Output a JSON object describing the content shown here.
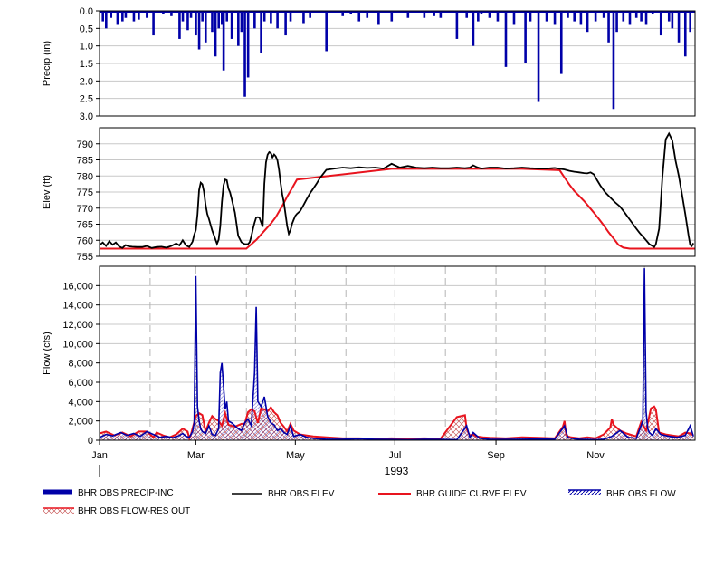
{
  "colors": {
    "precip": "#0000a8",
    "elev": "#000000",
    "guide": "#e8141e",
    "flow": "#0000a8",
    "resout": "#e8141e",
    "grid": "#c8c8c8",
    "vgrid": "#b4b4b4"
  },
  "chart_data": [
    {
      "type": "bar",
      "ylabel": "Precip (in)",
      "ylim": [
        0,
        3
      ],
      "y_inverted": true,
      "yticks": [
        "0.0",
        "0.5",
        "1.0",
        "1.5",
        "2.0",
        "2.5",
        "3.0"
      ],
      "ytick_values": [
        0,
        0.5,
        1,
        1.5,
        2,
        2.5,
        3
      ],
      "grid": true,
      "series": [
        {
          "name": "BHR OBS PRECIP-INC",
          "x_day": [
            3,
            5,
            8,
            12,
            15,
            17,
            22,
            25,
            30,
            34,
            40,
            45,
            50,
            52,
            55,
            57,
            60,
            62,
            64,
            66,
            70,
            72,
            74,
            76,
            77,
            79,
            82,
            86,
            88,
            90,
            92,
            96,
            100,
            102,
            106,
            110,
            115,
            118,
            126,
            130,
            140,
            150,
            155,
            160,
            165,
            172,
            180,
            190,
            200,
            206,
            210,
            220,
            226,
            230,
            233,
            235,
            240,
            245,
            250,
            255,
            262,
            265,
            270,
            275,
            280,
            284,
            288,
            292,
            296,
            300,
            305,
            310,
            313,
            316,
            318,
            322,
            326,
            330,
            333,
            336,
            340,
            345,
            350,
            352,
            356,
            360,
            363
          ],
          "values": [
            0.3,
            0.5,
            0.2,
            0.4,
            0.3,
            0.2,
            0.3,
            0.25,
            0.2,
            0.7,
            0.1,
            0.15,
            0.8,
            0.3,
            0.55,
            0.2,
            0.7,
            1.1,
            0.3,
            0.9,
            0.6,
            1.3,
            0.5,
            0.4,
            1.7,
            0.3,
            0.8,
            1.0,
            0.6,
            2.45,
            1.9,
            0.5,
            1.2,
            0.3,
            0.35,
            0.5,
            0.7,
            0.3,
            0.35,
            0.2,
            1.15,
            0.15,
            0.1,
            0.3,
            0.2,
            0.4,
            0.3,
            0.2,
            0.2,
            0.15,
            0.2,
            0.8,
            0.2,
            1.0,
            0.3,
            0.1,
            0.2,
            0.3,
            1.6,
            0.4,
            1.5,
            0.3,
            2.6,
            0.3,
            0.4,
            1.8,
            0.2,
            0.3,
            0.4,
            0.6,
            0.3,
            0.2,
            0.9,
            2.8,
            0.6,
            0.3,
            0.4,
            0.2,
            0.3,
            0.4,
            0.1,
            0.7,
            0.3,
            0.5,
            0.9,
            1.3,
            0.6
          ]
        }
      ]
    },
    {
      "type": "line",
      "ylabel": "Elev (ft)",
      "ylim": [
        755,
        795
      ],
      "yticks": [
        "755",
        "760",
        "765",
        "770",
        "775",
        "780",
        "785",
        "790"
      ],
      "ytick_values": [
        755,
        760,
        765,
        770,
        775,
        780,
        785,
        790
      ],
      "grid": true,
      "series": [
        {
          "name": "BHR OBS ELEV",
          "x_day": [
            1,
            3,
            5,
            7,
            9,
            11,
            13,
            15,
            17,
            19,
            21,
            24,
            27,
            30,
            33,
            36,
            39,
            42,
            45,
            48,
            50,
            52,
            54,
            56,
            58,
            59,
            60,
            61,
            62,
            63,
            64,
            65,
            66,
            67,
            68,
            70,
            72,
            73,
            74,
            75,
            76,
            77,
            78,
            79,
            80,
            81,
            82,
            84,
            86,
            88,
            90,
            92,
            93,
            94,
            95,
            96,
            97,
            98,
            99,
            100,
            101,
            102,
            103,
            104,
            105,
            106,
            107,
            108,
            109,
            110,
            111,
            112,
            113,
            114,
            115,
            116,
            117,
            118,
            119,
            120,
            121,
            122,
            124,
            126,
            128,
            130,
            132,
            134,
            136,
            138,
            140,
            145,
            150,
            155,
            160,
            165,
            170,
            175,
            180,
            185,
            190,
            195,
            200,
            205,
            210,
            215,
            220,
            225,
            228,
            230,
            232,
            235,
            240,
            245,
            250,
            255,
            260,
            265,
            270,
            275,
            278,
            280,
            283,
            286,
            289,
            292,
            295,
            298,
            300,
            302,
            304,
            306,
            308,
            311,
            314,
            317,
            320,
            323,
            326,
            329,
            332,
            335,
            338,
            341,
            342,
            344,
            346,
            348,
            350,
            352,
            354,
            356,
            358,
            360,
            362,
            363,
            364,
            365
          ],
          "values": [
            758.5,
            759.3,
            758.2,
            759.7,
            758.6,
            759.3,
            758.1,
            757.6,
            758.5,
            758.1,
            758.0,
            757.9,
            757.9,
            758.2,
            757.6,
            757.9,
            758.0,
            757.7,
            758.2,
            759.0,
            758.4,
            760.0,
            758.4,
            757.9,
            759.6,
            761.7,
            763.2,
            768.0,
            775.6,
            777.9,
            777.4,
            775.1,
            771.0,
            768.2,
            766.7,
            763.1,
            760.3,
            758.9,
            760.2,
            764.4,
            771.9,
            777.1,
            778.9,
            778.7,
            776.1,
            774.9,
            772.9,
            768.6,
            761.4,
            759.4,
            758.8,
            758.8,
            759.4,
            761.2,
            763.5,
            765.5,
            767.1,
            767.2,
            767.0,
            765.6,
            764.2,
            777.6,
            784.2,
            786.6,
            787.4,
            787.1,
            785.8,
            786.7,
            786.1,
            784.9,
            781.9,
            777.7,
            774.3,
            771.7,
            768.1,
            764.4,
            762.0,
            763.1,
            765.1,
            766.4,
            767.6,
            768.2,
            769.1,
            770.9,
            772.8,
            774.6,
            776.1,
            777.6,
            779.3,
            780.6,
            781.9,
            782.3,
            782.6,
            782.4,
            782.7,
            782.5,
            782.6,
            782.3,
            783.8,
            782.6,
            783.1,
            782.6,
            782.4,
            782.6,
            782.4,
            782.4,
            782.6,
            782.4,
            782.6,
            783.3,
            782.8,
            782.3,
            782.6,
            782.6,
            782.3,
            782.4,
            782.6,
            782.4,
            782.3,
            782.3,
            782.4,
            782.5,
            782.2,
            782.0,
            781.6,
            781.3,
            781.1,
            780.9,
            780.8,
            781.1,
            780.5,
            778.7,
            777.0,
            774.9,
            773.3,
            771.8,
            770.5,
            768.5,
            766.4,
            764.3,
            762.3,
            760.6,
            758.8,
            757.9,
            758.8,
            763.6,
            779.5,
            791.4,
            793.2,
            791.1,
            784.9,
            780.1,
            774.3,
            768.2,
            761.5,
            758.6,
            758.2,
            759.1,
            760.6,
            759.9,
            759.4
          ]
        },
        {
          "name": "BHR GUIDE CURVE ELEV",
          "x_day": [
            1,
            91,
            106,
            122,
            366,
            330,
            360
          ],
          "values": [
            757.4,
            757.4,
            767.8,
            782.2,
            782.2,
            757.4,
            757.4
          ],
          "points_x": [
            1,
            91,
            97,
            103,
            106,
            109,
            113,
            116,
            119,
            122,
            180,
            240,
            260,
            283,
            286,
            289,
            292,
            295,
            298,
            301,
            304,
            307,
            310,
            313,
            316,
            319,
            322,
            326,
            330,
            345,
            366
          ],
          "points_y": [
            757.4,
            757.4,
            760.1,
            763.5,
            765.2,
            767.2,
            770.7,
            773.6,
            776.2,
            778.9,
            782.2,
            782.2,
            782.2,
            781.8,
            779.5,
            777.3,
            775.3,
            773.8,
            772.2,
            770.4,
            768.6,
            766.7,
            764.7,
            762.5,
            760.6,
            758.6,
            757.7,
            757.4,
            757.4,
            757.4,
            757.4
          ]
        }
      ]
    },
    {
      "type": "line",
      "ylabel": "Flow (cfs)",
      "ylim": [
        0,
        18000
      ],
      "yticks": [
        "0",
        "2,000",
        "4,000",
        "6,000",
        "8,000",
        "10,000",
        "12,000",
        "14,000",
        "16,000"
      ],
      "ytick_values": [
        0,
        2000,
        4000,
        6000,
        8000,
        10000,
        12000,
        14000,
        16000
      ],
      "grid": true,
      "xticks": [
        "Jan",
        "Mar",
        "May",
        "Jul",
        "Sep",
        "Nov"
      ],
      "xtick_days": [
        1,
        60,
        121,
        182,
        244,
        305
      ],
      "xlabel": "1993",
      "series": [
        {
          "name": "BHR OBS FLOW",
          "x_day": [
            1,
            5,
            9,
            14,
            18,
            22,
            26,
            30,
            34,
            38,
            42,
            46,
            50,
            52,
            54,
            56,
            58,
            59,
            60,
            61,
            62,
            63,
            64,
            66,
            68,
            70,
            72,
            74,
            75,
            76,
            78,
            79,
            80,
            82,
            84,
            86,
            88,
            90,
            92,
            94,
            96,
            97,
            98,
            100,
            102,
            104,
            106,
            108,
            110,
            112,
            114,
            116,
            118,
            120,
            124,
            128,
            132,
            136,
            140,
            150,
            160,
            170,
            180,
            190,
            200,
            210,
            220,
            226,
            228,
            230,
            234,
            240,
            250,
            260,
            270,
            280,
            286,
            288,
            290,
            295,
            300,
            305,
            310,
            315,
            320,
            325,
            330,
            334,
            335,
            336,
            337,
            338,
            340,
            342,
            345,
            350,
            355,
            360,
            363,
            365
          ],
          "values": [
            300,
            600,
            450,
            800,
            500,
            700,
            400,
            900,
            600,
            300,
            400,
            250,
            500,
            700,
            400,
            300,
            900,
            1800,
            17000,
            3500,
            2000,
            1200,
            900,
            700,
            1500,
            600,
            500,
            1200,
            7000,
            8000,
            3200,
            4000,
            2000,
            1800,
            1500,
            1200,
            1000,
            1800,
            2200,
            1500,
            7000,
            13800,
            4000,
            3500,
            4500,
            2500,
            1800,
            1600,
            1000,
            1200,
            800,
            600,
            1500,
            400,
            600,
            300,
            200,
            150,
            100,
            100,
            150,
            100,
            80,
            60,
            100,
            80,
            60,
            1500,
            300,
            800,
            200,
            100,
            80,
            100,
            120,
            100,
            1500,
            300,
            200,
            100,
            80,
            60,
            100,
            400,
            1000,
            300,
            200,
            2000,
            17800,
            3000,
            1200,
            800,
            500,
            1200,
            600,
            400,
            300,
            500,
            1500,
            400
          ]
        },
        {
          "name": "BHR OBS FLOW-RES OUT",
          "x_day": [
            1,
            5,
            10,
            15,
            20,
            25,
            30,
            34,
            36,
            40,
            44,
            48,
            52,
            55,
            56,
            57,
            60,
            62,
            64,
            66,
            68,
            70,
            72,
            74,
            76,
            78,
            80,
            84,
            88,
            90,
            92,
            94,
            96,
            98,
            100,
            102,
            104,
            106,
            108,
            110,
            112,
            114,
            116,
            118,
            120,
            124,
            128,
            132,
            140,
            150,
            160,
            170,
            180,
            190,
            200,
            210,
            220,
            225,
            226,
            227,
            228,
            230,
            232,
            236,
            240,
            250,
            260,
            270,
            280,
            285,
            286,
            287,
            288,
            290,
            295,
            300,
            305,
            310,
            314,
            315,
            316,
            320,
            324,
            328,
            330,
            333,
            336,
            339,
            341,
            342,
            344,
            348,
            352,
            356,
            360,
            363,
            365
          ],
          "values": [
            700,
            900,
            500,
            800,
            400,
            900,
            900,
            300,
            800,
            500,
            300,
            600,
            1200,
            900,
            200,
            600,
            2500,
            2800,
            2600,
            900,
            1800,
            2500,
            2200,
            2000,
            1500,
            2800,
            1600,
            1400,
            1700,
            1700,
            2900,
            3200,
            3000,
            1800,
            3300,
            3200,
            3000,
            3400,
            2900,
            2600,
            1800,
            1400,
            900,
            1700,
            1000,
            600,
            500,
            400,
            300,
            200,
            200,
            150,
            200,
            150,
            200,
            150,
            2400,
            2600,
            1200,
            800,
            500,
            600,
            400,
            300,
            250,
            200,
            300,
            250,
            200,
            1400,
            2000,
            600,
            400,
            300,
            200,
            300,
            200,
            600,
            1300,
            2200,
            1600,
            1000,
            700,
            500,
            400,
            1900,
            1000,
            3300,
            3500,
            3200,
            800,
            600,
            500,
            400,
            800,
            700,
            500
          ]
        }
      ]
    }
  ],
  "legend": {
    "items": [
      {
        "label": "BHR OBS PRECIP-INC"
      },
      {
        "label": "BHR OBS ELEV"
      },
      {
        "label": "BHR GUIDE CURVE ELEV"
      },
      {
        "label": "BHR OBS FLOW"
      },
      {
        "label": "BHR OBS FLOW-RES OUT"
      }
    ]
  }
}
